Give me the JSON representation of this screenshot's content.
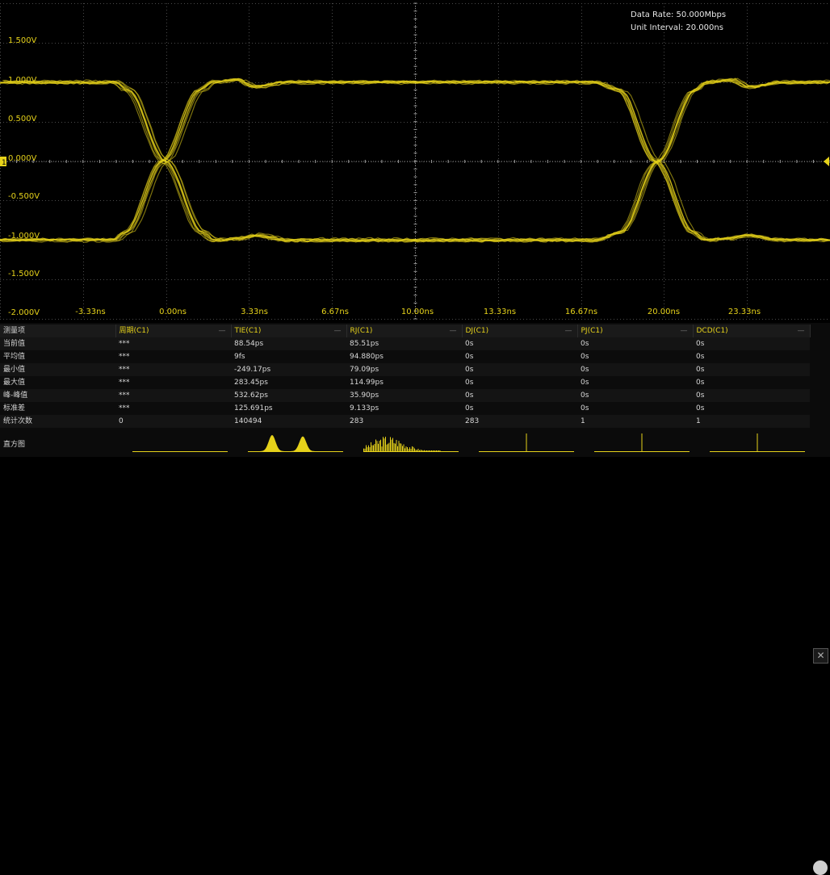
{
  "scope": {
    "info": {
      "data_rate": "Data Rate: 50.000Mbps",
      "unit_interval": "Unit Interval: 20.000ns"
    },
    "y_labels": [
      "1.500V",
      "1.000V",
      "0.500V",
      "0.000V",
      "-0.500V",
      "-1.000V",
      "-1.500V",
      "-2.000V"
    ],
    "x_labels": [
      "-3.33ns",
      "0.00ns",
      "3.33ns",
      "6.67ns",
      "10.00ns",
      "13.33ns",
      "16.67ns",
      "20.00ns",
      "23.33ns"
    ],
    "trace_color": "#e6d21a",
    "channel_marker": "1"
  },
  "chart_data": {
    "type": "line",
    "title": "",
    "xlabel": "",
    "ylabel": "",
    "x_unit": "ns",
    "y_unit": "V",
    "xlim": [
      -6.7,
      27.0
    ],
    "ylim": [
      -2.0,
      2.0
    ],
    "grid": true,
    "series": [
      {
        "x": [
          -6.7,
          -4.5,
          -2.0,
          -1.5,
          0.0,
          1.5,
          2.0,
          3.0,
          3.7,
          5.0,
          16.0,
          17.5,
          18.5,
          20.0,
          21.5,
          22.0,
          23.0,
          23.7,
          25.0,
          27.0
        ],
        "y": [
          1.0,
          1.0,
          1.0,
          0.9,
          0.0,
          -0.9,
          -1.0,
          -0.98,
          -0.94,
          -1.0,
          -1.0,
          -1.0,
          -0.9,
          0.0,
          0.9,
          1.0,
          1.03,
          0.94,
          1.0,
          1.0
        ]
      },
      {
        "x": [
          -6.7,
          -4.5,
          -2.0,
          -1.5,
          0.0,
          1.5,
          2.0,
          3.0,
          3.7,
          5.0,
          16.0,
          17.5,
          18.5,
          20.0,
          21.5,
          22.0,
          23.0,
          23.7,
          25.0,
          27.0
        ],
        "y": [
          -1.0,
          -1.0,
          -1.0,
          -0.9,
          0.0,
          0.9,
          1.0,
          1.03,
          0.94,
          1.0,
          1.0,
          1.0,
          0.9,
          0.0,
          -0.9,
          -1.0,
          -0.98,
          -0.94,
          -1.0,
          -1.0
        ]
      }
    ]
  },
  "measurements": {
    "columns": [
      "测量项",
      "周期(C1)",
      "TIE(C1)",
      "RJ(C1)",
      "DJ(C1)",
      "PJ(C1)",
      "DCD(C1)"
    ],
    "rows": [
      [
        "当前值",
        "***",
        "88.54ps",
        "85.51ps",
        "0s",
        "0s",
        "0s"
      ],
      [
        "平均值",
        "***",
        "9fs",
        "94.880ps",
        "0s",
        "0s",
        "0s"
      ],
      [
        "最小值",
        "***",
        "-249.17ps",
        "79.09ps",
        "0s",
        "0s",
        "0s"
      ],
      [
        "最大值",
        "***",
        "283.45ps",
        "114.99ps",
        "0s",
        "0s",
        "0s"
      ],
      [
        "峰-峰值",
        "***",
        "532.62ps",
        "35.90ps",
        "0s",
        "0s",
        "0s"
      ],
      [
        "标准差",
        "***",
        "125.691ps",
        "9.133ps",
        "0s",
        "0s",
        "0s"
      ],
      [
        "统计次数",
        "0",
        "140494",
        "283",
        "283",
        "1",
        "1"
      ]
    ],
    "histogram_label": "直方图",
    "histograms": [
      {
        "kind": "flat"
      },
      {
        "kind": "bimodal"
      },
      {
        "kind": "noisy"
      },
      {
        "kind": "spike"
      },
      {
        "kind": "spike"
      },
      {
        "kind": "spike"
      }
    ],
    "close_icon": "close-icon",
    "settings_icon": "gear-icon"
  }
}
